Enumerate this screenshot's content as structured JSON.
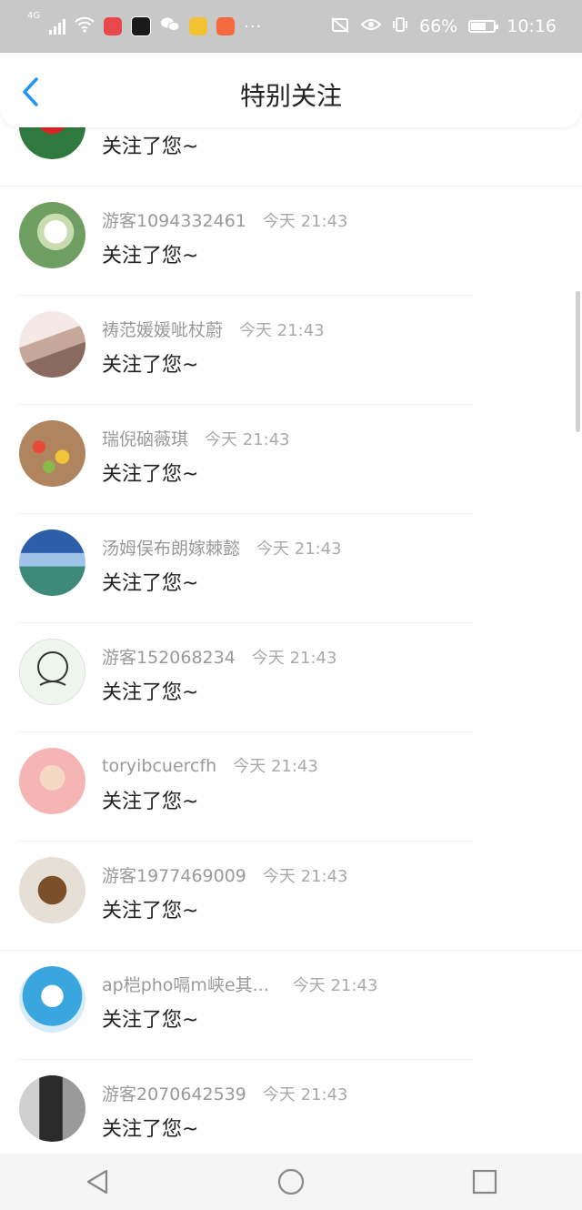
{
  "status_bar": {
    "network": "4G",
    "battery": "66%",
    "time": "10:16",
    "more": "···"
  },
  "header": {
    "title": "特别关注",
    "back_icon": "chevron-left-icon"
  },
  "items": [
    {
      "name": "",
      "time": "",
      "message": "关注了您~",
      "avatar_color": "#2f7a3f"
    },
    {
      "name": "游客1094332461",
      "time": "今天 21:43",
      "message": "关注了您~",
      "avatar_color": "#7aa57a"
    },
    {
      "name": "祷范媛媛呲杖蔚",
      "time": "今天 21:43",
      "message": "关注了您~",
      "avatar_color": "#d9c8c0"
    },
    {
      "name": "瑞倪硇薇琪",
      "time": "今天 21:43",
      "message": "关注了您~",
      "avatar_color": "#a8785a"
    },
    {
      "name": "汤姆俣布朗嫁棘懿",
      "time": "今天 21:43",
      "message": "关注了您~",
      "avatar_color": "#3d6fa8"
    },
    {
      "name": "游客152068234",
      "time": "今天 21:43",
      "message": "关注了您~",
      "avatar_color": "#e9f3e9"
    },
    {
      "name": "toryibcuercfh",
      "time": "今天 21:43",
      "message": "关注了您~",
      "avatar_color": "#f0b8b8"
    },
    {
      "name": "游客1977469009",
      "time": "今天 21:43",
      "message": "关注了您~",
      "avatar_color": "#8a6a4a"
    },
    {
      "name": "ap桤pho嗝m峡e其...",
      "time": "今天 21:43",
      "message": "关注了您~",
      "avatar_color": "#5fb8e8"
    },
    {
      "name": "游客2070642539",
      "time": "今天 21:43",
      "message": "关注了您~",
      "avatar_color": "#6a6a6a"
    }
  ],
  "nav_bar": {
    "back": "back-triangle-icon",
    "home": "home-circle-icon",
    "recents": "recents-square-icon"
  }
}
